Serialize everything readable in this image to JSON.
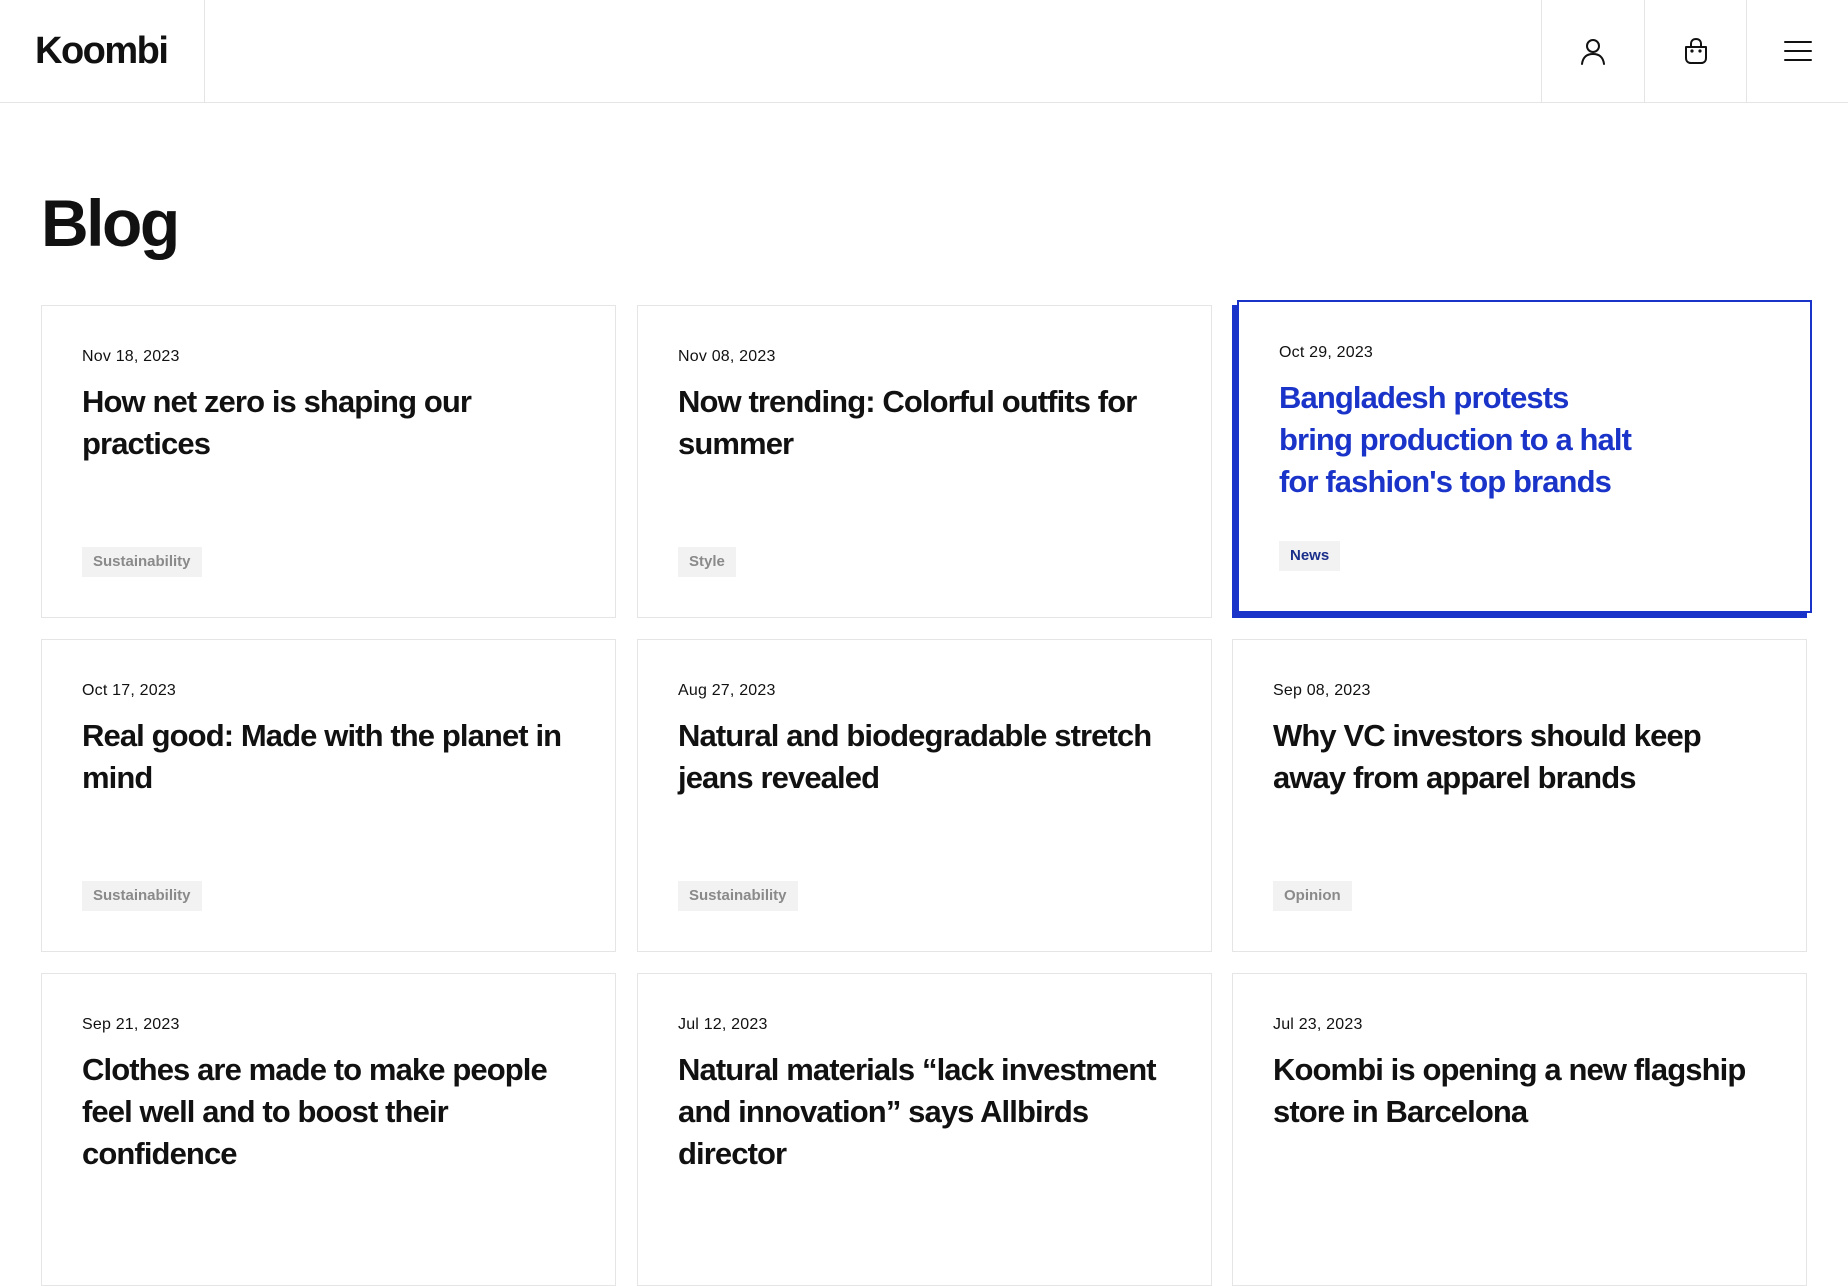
{
  "header": {
    "logo": "Koombi",
    "icons": [
      "user-icon",
      "shopping-bag-icon",
      "menu-icon"
    ]
  },
  "page": {
    "title": "Blog"
  },
  "colors": {
    "accent": "#1a33c8",
    "tag_bg": "#f2f2f2",
    "tag_text": "#8a8a8a",
    "border": "#e5e5e5"
  },
  "posts": [
    {
      "date": "Nov 18, 2023",
      "title": "How net zero is shaping our practices",
      "tag": "Sustainability"
    },
    {
      "date": "Nov 08, 2023",
      "title": "Now trending: Colorful outfits for summer",
      "tag": "Style"
    },
    {
      "date": "Oct 29, 2023",
      "title": "Bangladesh protests bring production to a halt for fashion's top brands",
      "tag": "News",
      "active": true
    },
    {
      "date": "Oct 17, 2023",
      "title": "Real good: Made with the planet in mind",
      "tag": "Sustainability"
    },
    {
      "date": "Aug 27, 2023",
      "title": "Natural and biodegradable stretch jeans revealed",
      "tag": "Sustainability"
    },
    {
      "date": "Sep 08, 2023",
      "title": "Why VC investors should keep away from apparel brands",
      "tag": "Opinion"
    },
    {
      "date": "Sep 21, 2023",
      "title": "Clothes are made to make people feel well and to boost their confidence",
      "tag": ""
    },
    {
      "date": "Jul 12, 2023",
      "title": "Natural materials “lack investment and innovation” says Allbirds director",
      "tag": ""
    },
    {
      "date": "Jul 23, 2023",
      "title": "Koombi is opening a new flagship store in Barcelona",
      "tag": ""
    }
  ]
}
